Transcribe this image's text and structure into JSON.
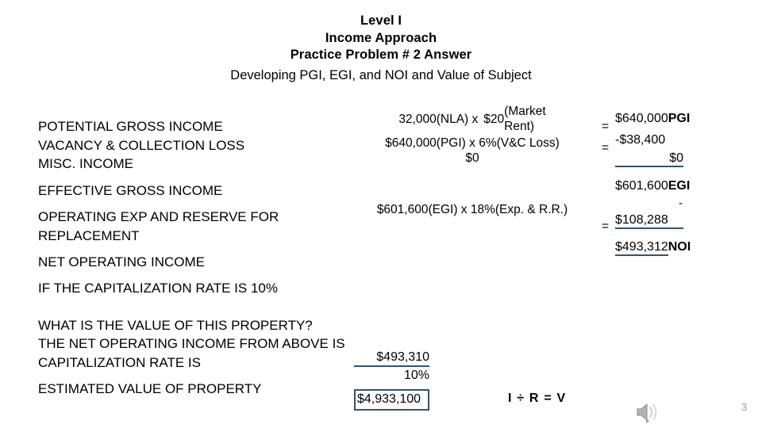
{
  "slide": {
    "page_number": "3",
    "accent_color": "#31546F",
    "page_number_color": "#9B9B9B"
  },
  "title": {
    "line1": "Level I",
    "line2": "Income Approach",
    "line3": "Practice Problem # 2 Answer",
    "subtitle": "Developing PGI, EGI, and NOI and Value of Subject"
  },
  "labels": {
    "potential_gross_income": "POTENTIAL GROSS INCOME",
    "vacancy_collection_loss": "VACANCY & COLLECTION LOSS",
    "misc_income": "MISC. INCOME",
    "effective_gross_income": "EFFECTIVE GROSS INCOME",
    "operating_exp": "OPERATING EXP AND RESERVE FOR REPLACEMENT",
    "net_operating_income": "NET OPERATING INCOME"
  },
  "calculations": {
    "row1": {
      "factor_a": "32,000(NLA) x",
      "factor_b": "$20",
      "note_line1": "(Market",
      "note_line2": "Rent)"
    },
    "row2": {
      "text": "$640,000(PGI)  x   6%(V&C Loss)"
    },
    "row3": {
      "text": "$0"
    },
    "row4": {
      "text": "$601,600(EGI)  x  18%(Exp. & R.R.)"
    },
    "equals": "="
  },
  "results": {
    "pgi_value": "$640,000",
    "pgi_tag": "PGI",
    "vc_value": "-$38,400",
    "misc_value": "$0",
    "egi_value": "$601,600",
    "egi_tag": "EGI",
    "minus_sign": "-",
    "oe_value": "$108,288",
    "noi_value": "$493,312",
    "noi_tag": "NOI"
  },
  "bottom": {
    "cap_rate_question": "IF THE CAPITALIZATION RATE IS 10%",
    "value_question": "WHAT IS THE VALUE OF THIS PROPERTY?",
    "noi_from_above": "THE NET OPERATING INCOME FROM ABOVE IS",
    "capitalization_rate_is": "CAPITALIZATION RATE IS",
    "estimated_value": "ESTIMATED VALUE OF PROPERTY",
    "noi_value": "$493,310",
    "cap_rate_value": "10%",
    "estimated_value_amount": "$4,933,100",
    "formula": "I ÷ R = V"
  }
}
